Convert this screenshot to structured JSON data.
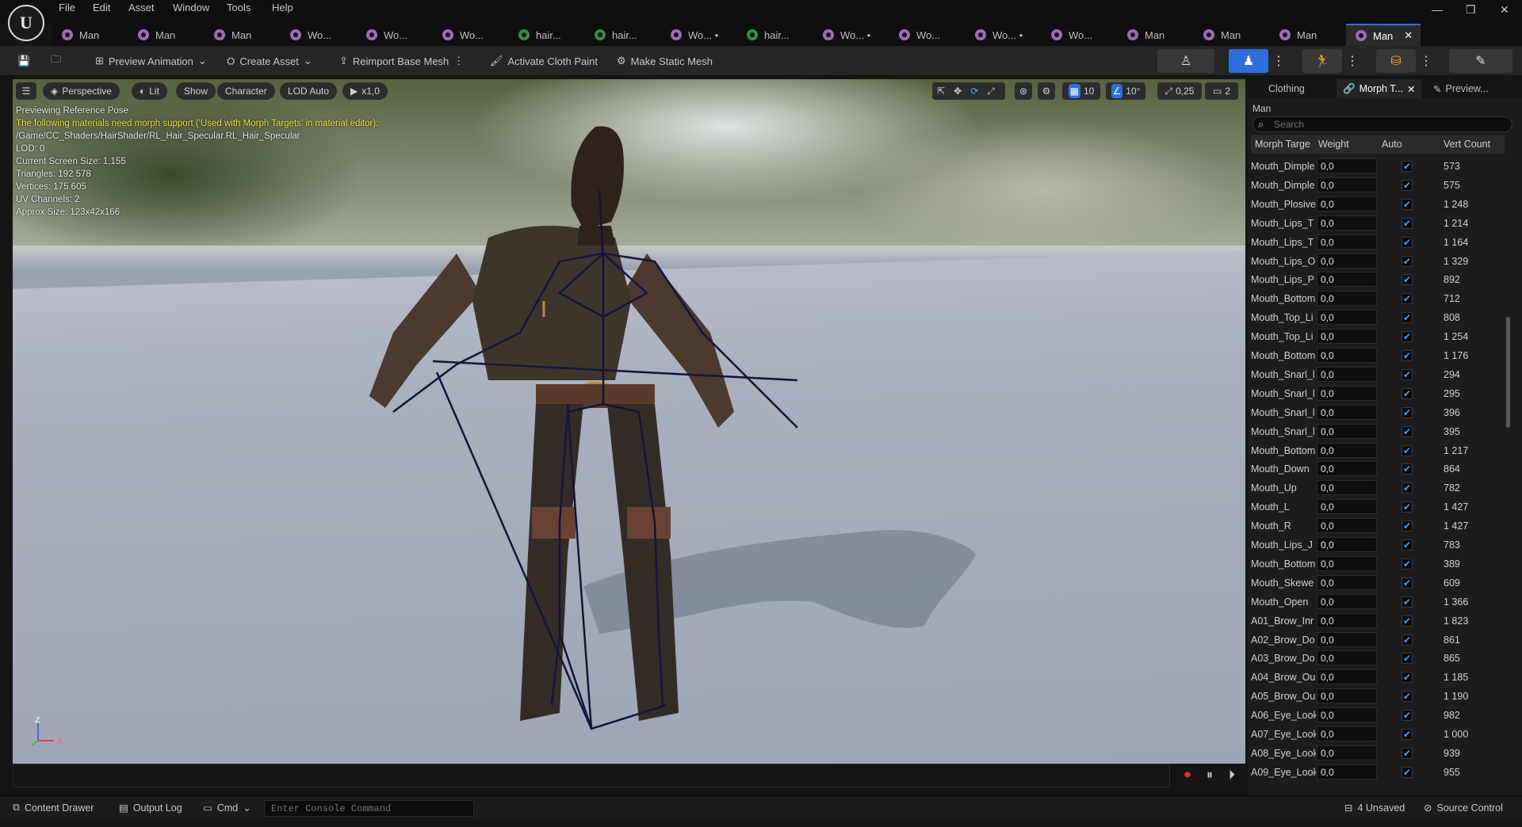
{
  "menu": [
    "File",
    "Edit",
    "Asset",
    "Window",
    "Tools",
    "Help"
  ],
  "logo": "U",
  "window_controls": {
    "minimize": "—",
    "restore": "❐",
    "close": "✕"
  },
  "tabs": [
    {
      "label": "Man",
      "icon": "p"
    },
    {
      "label": "Man",
      "icon": "p"
    },
    {
      "label": "Man",
      "icon": "p"
    },
    {
      "label": "Wo...",
      "icon": "p"
    },
    {
      "label": "Wo...",
      "icon": "p"
    },
    {
      "label": "Wo...",
      "icon": "p"
    },
    {
      "label": "hair...",
      "icon": "g"
    },
    {
      "label": "hair...",
      "icon": "g"
    },
    {
      "label": "Wo... •",
      "icon": "p"
    },
    {
      "label": "hair...",
      "icon": "g"
    },
    {
      "label": "Wo... •",
      "icon": "p"
    },
    {
      "label": "Wo...",
      "icon": "p"
    },
    {
      "label": "Wo... •",
      "icon": "p"
    },
    {
      "label": "Wo...",
      "icon": "p"
    },
    {
      "label": "Man",
      "icon": "p"
    },
    {
      "label": "Man",
      "icon": "p"
    },
    {
      "label": "Man",
      "icon": "p"
    },
    {
      "label": "Man",
      "icon": "p",
      "active": true
    }
  ],
  "toolbar": {
    "preview_animation": "Preview Animation",
    "create_asset": "Create Asset",
    "reimport": "Reimport Base Mesh",
    "activate_cloth": "Activate Cloth Paint",
    "make_static": "Make Static Mesh"
  },
  "viewport": {
    "perspective": "Perspective",
    "lit": "Lit",
    "show": "Show",
    "character": "Character",
    "lod": "LOD Auto",
    "speed": "x1,0",
    "grid": "10",
    "angle": "10°",
    "scale": "0,25",
    "cam_speed": "2",
    "stats": [
      {
        "text": "Previewing Reference Pose",
        "warn": false
      },
      {
        "text": "The following materials need morph support ('Used with Morph Targets' in material editor):",
        "warn": true
      },
      {
        "text": "/Game/CC_Shaders/HairShader/RL_Hair_Specular.RL_Hair_Specular",
        "warn": false
      },
      {
        "text": "LOD: 0",
        "warn": false
      },
      {
        "text": "Current Screen Size: 1,155",
        "warn": false
      },
      {
        "text": "Triangles: 192 578",
        "warn": false
      },
      {
        "text": "Vertices: 175 605",
        "warn": false
      },
      {
        "text": "UV Channels: 2",
        "warn": false
      },
      {
        "text": "Approx Size: 123x42x166",
        "warn": false
      }
    ],
    "axis_z": "Z",
    "axis_x": "X"
  },
  "panel": {
    "tabs": [
      "Clothing",
      "Morph T...",
      "Preview..."
    ],
    "mesh_name": "Man",
    "search_placeholder": "Search",
    "columns": [
      "Morph Targe",
      "Weight",
      "Auto",
      "Vert Count"
    ],
    "rows": [
      {
        "name": "Mouth_Dimple",
        "weight": "0,0",
        "verts": "573"
      },
      {
        "name": "Mouth_Dimple",
        "weight": "0,0",
        "verts": "575"
      },
      {
        "name": "Mouth_Plosive",
        "weight": "0,0",
        "verts": "1 248"
      },
      {
        "name": "Mouth_Lips_T",
        "weight": "0,0",
        "verts": "1 214"
      },
      {
        "name": "Mouth_Lips_T",
        "weight": "0,0",
        "verts": "1 164"
      },
      {
        "name": "Mouth_Lips_O",
        "weight": "0,0",
        "verts": "1 329"
      },
      {
        "name": "Mouth_Lips_P",
        "weight": "0,0",
        "verts": "892"
      },
      {
        "name": "Mouth_Bottom",
        "weight": "0,0",
        "verts": "712"
      },
      {
        "name": "Mouth_Top_Li",
        "weight": "0,0",
        "verts": "808"
      },
      {
        "name": "Mouth_Top_Li",
        "weight": "0,0",
        "verts": "1 254"
      },
      {
        "name": "Mouth_Bottom",
        "weight": "0,0",
        "verts": "1 176"
      },
      {
        "name": "Mouth_Snarl_l",
        "weight": "0,0",
        "verts": "294"
      },
      {
        "name": "Mouth_Snarl_l",
        "weight": "0,0",
        "verts": "295"
      },
      {
        "name": "Mouth_Snarl_l",
        "weight": "0,0",
        "verts": "396"
      },
      {
        "name": "Mouth_Snarl_l",
        "weight": "0,0",
        "verts": "395"
      },
      {
        "name": "Mouth_Bottom",
        "weight": "0,0",
        "verts": "1 217"
      },
      {
        "name": "Mouth_Down",
        "weight": "0,0",
        "verts": "864"
      },
      {
        "name": "Mouth_Up",
        "weight": "0,0",
        "verts": "782"
      },
      {
        "name": "Mouth_L",
        "weight": "0,0",
        "verts": "1 427"
      },
      {
        "name": "Mouth_R",
        "weight": "0,0",
        "verts": "1 427"
      },
      {
        "name": "Mouth_Lips_J",
        "weight": "0,0",
        "verts": "783"
      },
      {
        "name": "Mouth_Bottom",
        "weight": "0,0",
        "verts": "389"
      },
      {
        "name": "Mouth_Skewe",
        "weight": "0,0",
        "verts": "609"
      },
      {
        "name": "Mouth_Open",
        "weight": "0,0",
        "verts": "1 366"
      },
      {
        "name": "A01_Brow_Inr",
        "weight": "0,0",
        "verts": "1 823"
      },
      {
        "name": "A02_Brow_Do",
        "weight": "0,0",
        "verts": "861"
      },
      {
        "name": "A03_Brow_Do",
        "weight": "0,0",
        "verts": "865"
      },
      {
        "name": "A04_Brow_Ou",
        "weight": "0,0",
        "verts": "1 185"
      },
      {
        "name": "A05_Brow_Ou",
        "weight": "0,0",
        "verts": "1 190"
      },
      {
        "name": "A06_Eye_Look",
        "weight": "0,0",
        "verts": "982"
      },
      {
        "name": "A07_Eye_Look",
        "weight": "0,0",
        "verts": "1 000"
      },
      {
        "name": "A08_Eye_Look",
        "weight": "0,0",
        "verts": "939"
      },
      {
        "name": "A09_Eye_Look",
        "weight": "0,0",
        "verts": "955"
      }
    ]
  },
  "statusbar": {
    "content_drawer": "Content Drawer",
    "output_log": "Output Log",
    "cmd": "Cmd",
    "console_placeholder": "Enter Console Command",
    "unsaved": "4 Unsaved",
    "source_control": "Source Control"
  },
  "colors": {
    "accent": "#2f6fdc",
    "warning": "#f4e04a",
    "check": "#3b9ff4"
  }
}
